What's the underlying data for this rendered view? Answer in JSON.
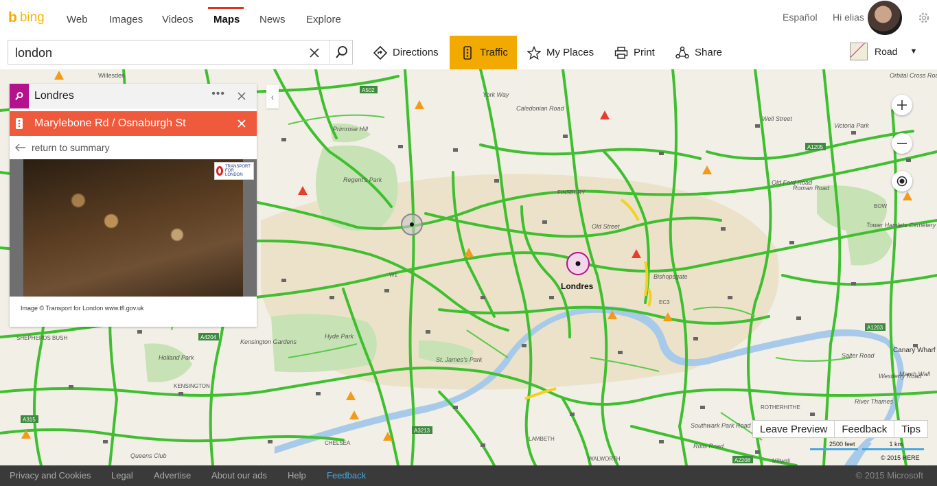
{
  "header": {
    "logo_text": "bing",
    "nav": [
      {
        "label": "Web"
      },
      {
        "label": "Images"
      },
      {
        "label": "Videos"
      },
      {
        "label": "Maps",
        "active": true
      },
      {
        "label": "News"
      },
      {
        "label": "Explore"
      }
    ],
    "language_link": "Español",
    "greeting": "Hi elias"
  },
  "toolbar": {
    "search_value": "london",
    "tools": [
      {
        "label": "Directions",
        "icon": "directions-icon"
      },
      {
        "label": "Traffic",
        "icon": "traffic-icon",
        "active": true
      },
      {
        "label": "My Places",
        "icon": "star-icon"
      },
      {
        "label": "Print",
        "icon": "printer-icon"
      },
      {
        "label": "Share",
        "icon": "share-icon"
      }
    ],
    "map_style": "Road"
  },
  "panel": {
    "search_result_title": "Londres",
    "incident_title": "Marylebone Rd / Osnaburgh St",
    "back_link": "return to summary",
    "camera_caption": "Image © Transport for London www.tfl.gov.uk",
    "camera_logo": "TRANSPORT FOR LONDON"
  },
  "map": {
    "pin_label": "Londres",
    "labels": [
      {
        "text": "Willesden"
      },
      {
        "text": "Primrose Hill"
      },
      {
        "text": "Regent's Park"
      },
      {
        "text": "Hyde Park"
      },
      {
        "text": "Kensington Gardens"
      },
      {
        "text": "Holland Park"
      },
      {
        "text": "KENSINGTON"
      },
      {
        "text": "St. James's Park"
      },
      {
        "text": "CHELSEA"
      },
      {
        "text": "LAMBETH"
      },
      {
        "text": "WALWORTH"
      },
      {
        "text": "FINSBURY"
      },
      {
        "text": "Old Street"
      },
      {
        "text": "EC3"
      },
      {
        "text": "W1"
      },
      {
        "text": "Victoria Park"
      },
      {
        "text": "Old Ford Road"
      },
      {
        "text": "Roman Road"
      },
      {
        "text": "Well Street"
      },
      {
        "text": "BOW"
      },
      {
        "text": "Tower Hamlets Cemetery"
      },
      {
        "text": "Orbital Cross Road"
      },
      {
        "text": "Canary Wharf"
      },
      {
        "text": "Marsh Wall"
      },
      {
        "text": "River Thames"
      },
      {
        "text": "ROTHERHITHE"
      },
      {
        "text": "Southwark Park Road"
      },
      {
        "text": "Rolls Road"
      },
      {
        "text": "SHEPHERDS BUSH"
      },
      {
        "text": "Queens Club"
      },
      {
        "text": "York Way"
      },
      {
        "text": "Caledonian Road"
      },
      {
        "text": "Salter Road"
      },
      {
        "text": "Westferry Road"
      },
      {
        "text": "Bishopsgate"
      },
      {
        "text": "Millwall"
      }
    ],
    "road_shields": [
      "A502",
      "A1205",
      "A4204",
      "A315",
      "A3213",
      "A1203",
      "A2208"
    ],
    "buttons": {
      "leave_preview": "Leave Preview",
      "feedback": "Feedback",
      "tips": "Tips"
    },
    "scale_feet": "2500 feet",
    "scale_km": "1 km",
    "copyright": "© 2015 HERE"
  },
  "footer": {
    "links": [
      "Privacy and Cookies",
      "Legal",
      "Advertise",
      "About our ads",
      "Help",
      "Feedback"
    ],
    "copyright": "© 2015 Microsoft"
  },
  "colors": {
    "traffic_active": "#f2a900",
    "incident_red": "#f05a3c",
    "result_purple": "#b4118c",
    "traffic_green": "#3fbf2f",
    "footer_bg": "#3a3a3a",
    "feedback_link": "#4aa8e0"
  }
}
